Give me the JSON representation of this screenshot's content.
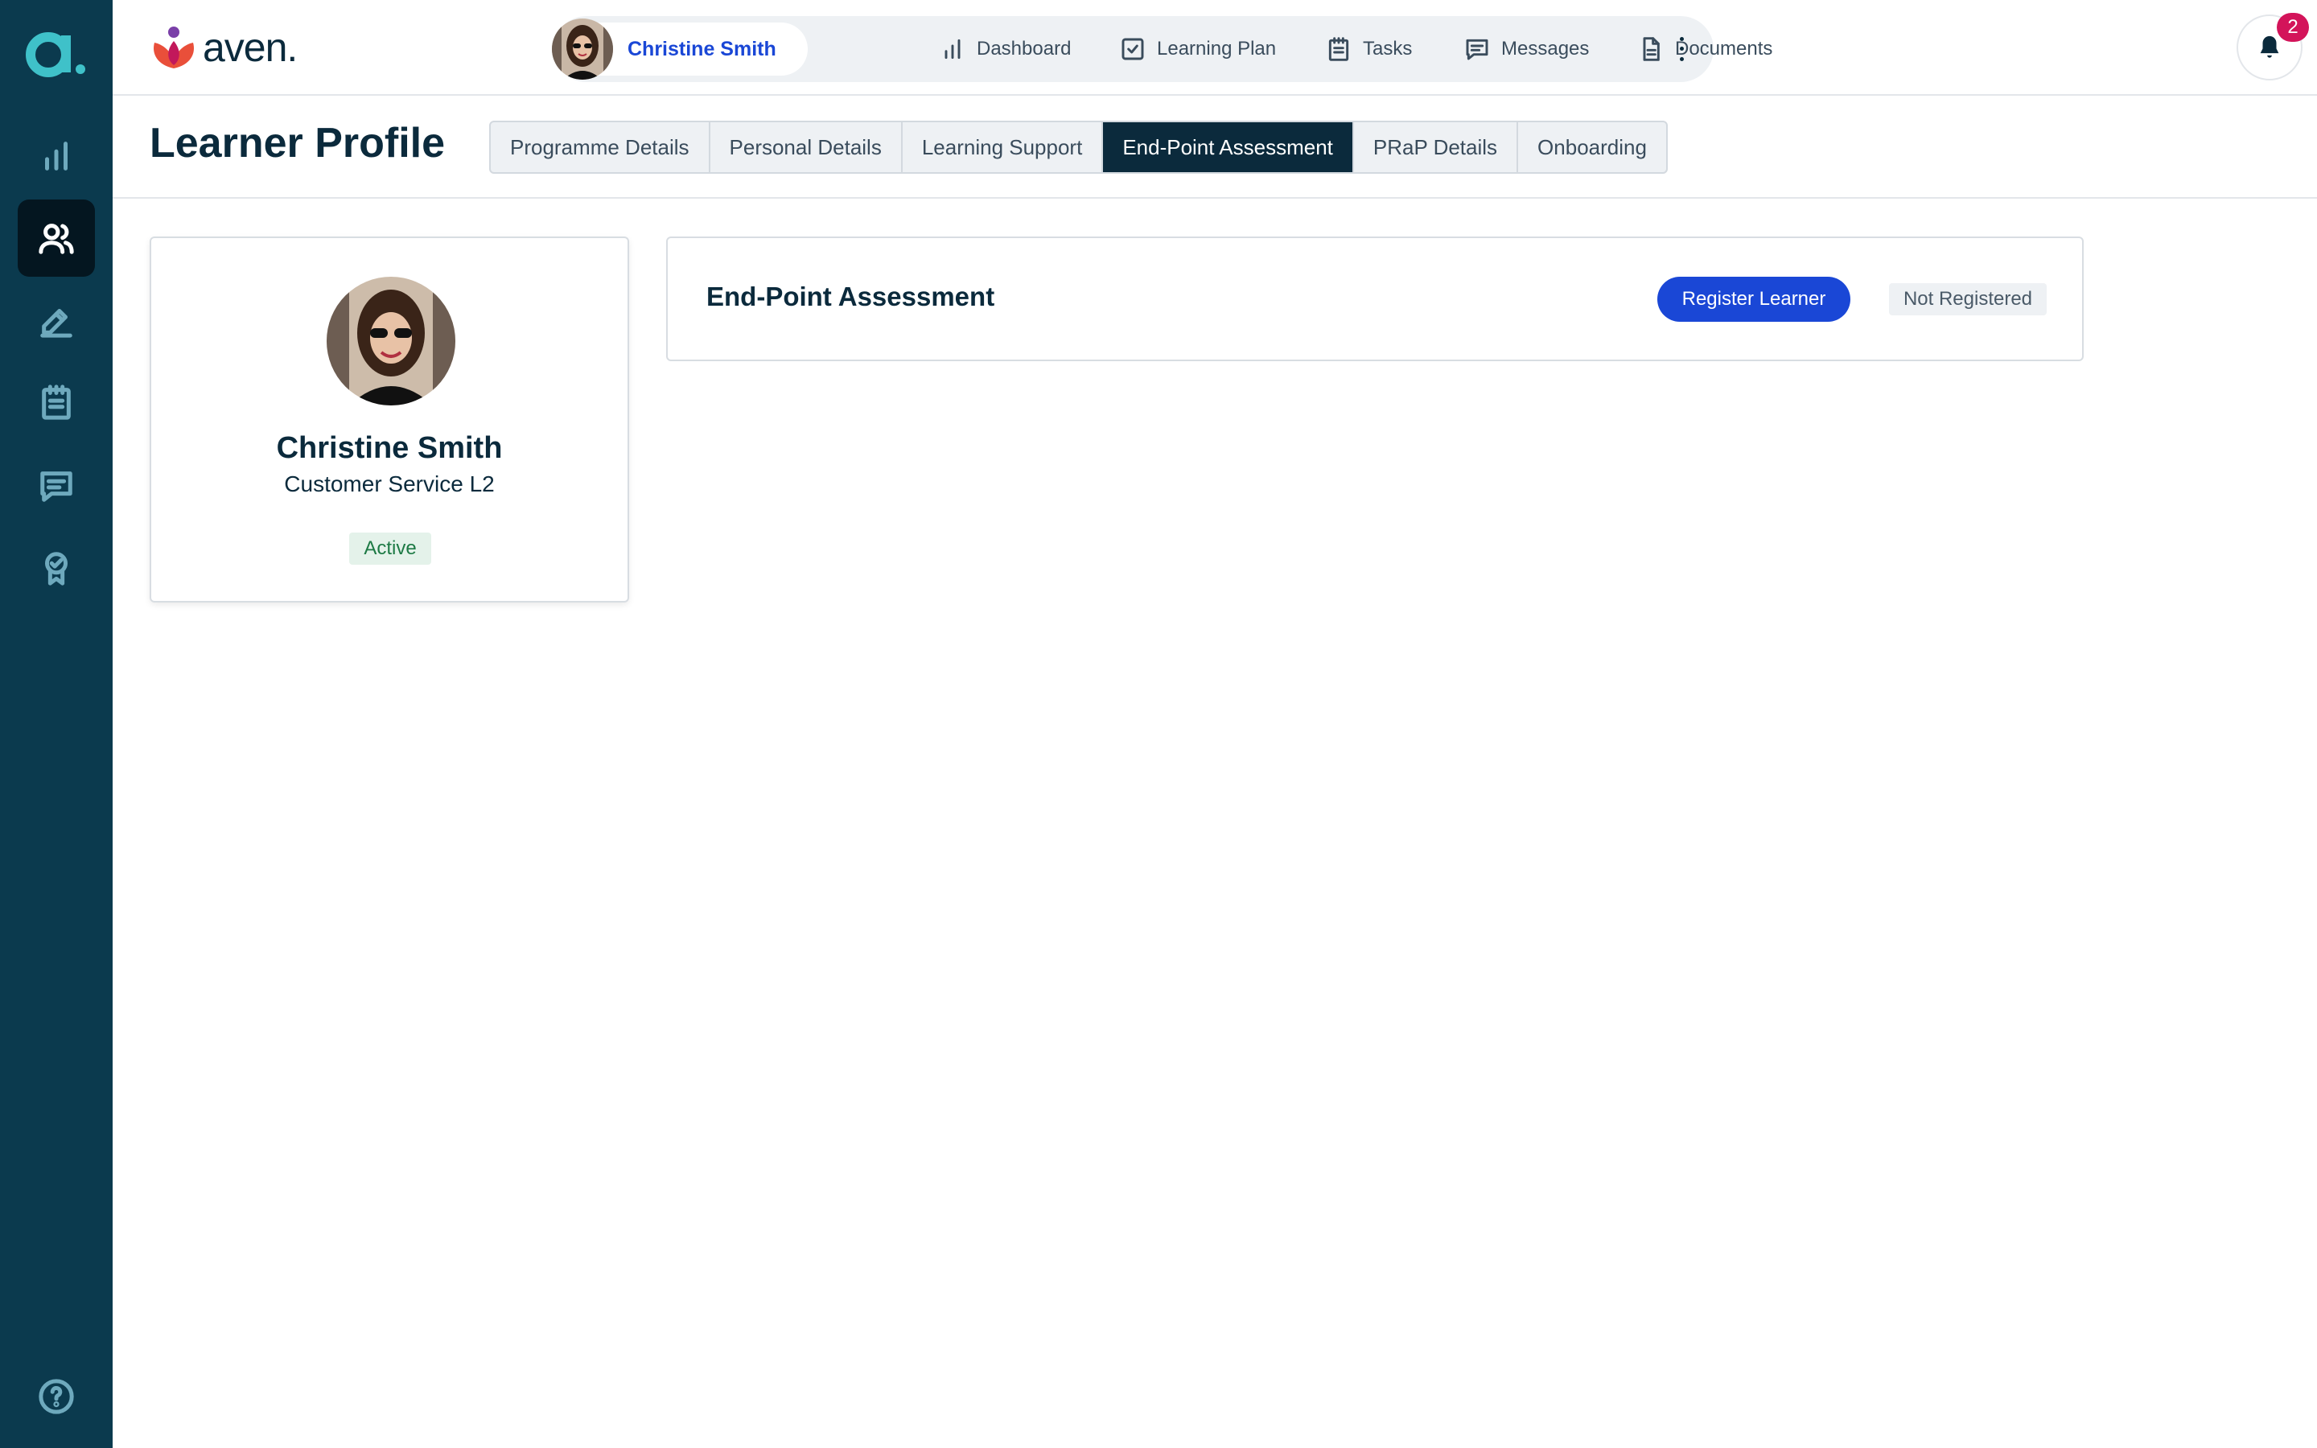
{
  "app": {
    "sidebar_logo_icon": "aven-a-logo-icon",
    "brand_name": "aven.",
    "brand_icon": "aven-flower-logo-icon",
    "colors": {
      "sidebar": "#0b3a4e",
      "accent": "#1a47d6",
      "notification": "#d3145a",
      "active_tab": "#0b2a3c"
    }
  },
  "sidebar": {
    "items": [
      {
        "icon": "bar-chart-icon",
        "active": false
      },
      {
        "icon": "users-icon",
        "active": true
      },
      {
        "icon": "pen-icon",
        "active": false
      },
      {
        "icon": "clipboard-icon",
        "active": false
      },
      {
        "icon": "message-icon",
        "active": false
      },
      {
        "icon": "award-icon",
        "active": false
      }
    ],
    "help_icon": "help-circle-icon"
  },
  "topnav": {
    "learner_name": "Christine Smith",
    "items": [
      {
        "label": "Dashboard",
        "icon": "bar-chart-icon"
      },
      {
        "label": "Learning Plan",
        "icon": "checkbox-icon"
      },
      {
        "label": "Tasks",
        "icon": "clipboard-icon"
      },
      {
        "label": "Messages",
        "icon": "message-icon"
      },
      {
        "label": "Documents",
        "icon": "document-icon"
      }
    ],
    "more_icon": "more-vertical-icon",
    "notification_count": "2"
  },
  "page": {
    "title": "Learner Profile",
    "tabs": [
      {
        "label": "Programme Details",
        "active": false
      },
      {
        "label": "Personal Details",
        "active": false
      },
      {
        "label": "Learning Support",
        "active": false
      },
      {
        "label": "End-Point Assessment",
        "active": true
      },
      {
        "label": "PRaP Details",
        "active": false
      },
      {
        "label": "Onboarding",
        "active": false
      }
    ]
  },
  "profile": {
    "name": "Christine Smith",
    "programme": "Customer Service L2",
    "status": "Active"
  },
  "epa": {
    "title": "End-Point Assessment",
    "register_label": "Register Learner",
    "registration_status": "Not Registered"
  }
}
